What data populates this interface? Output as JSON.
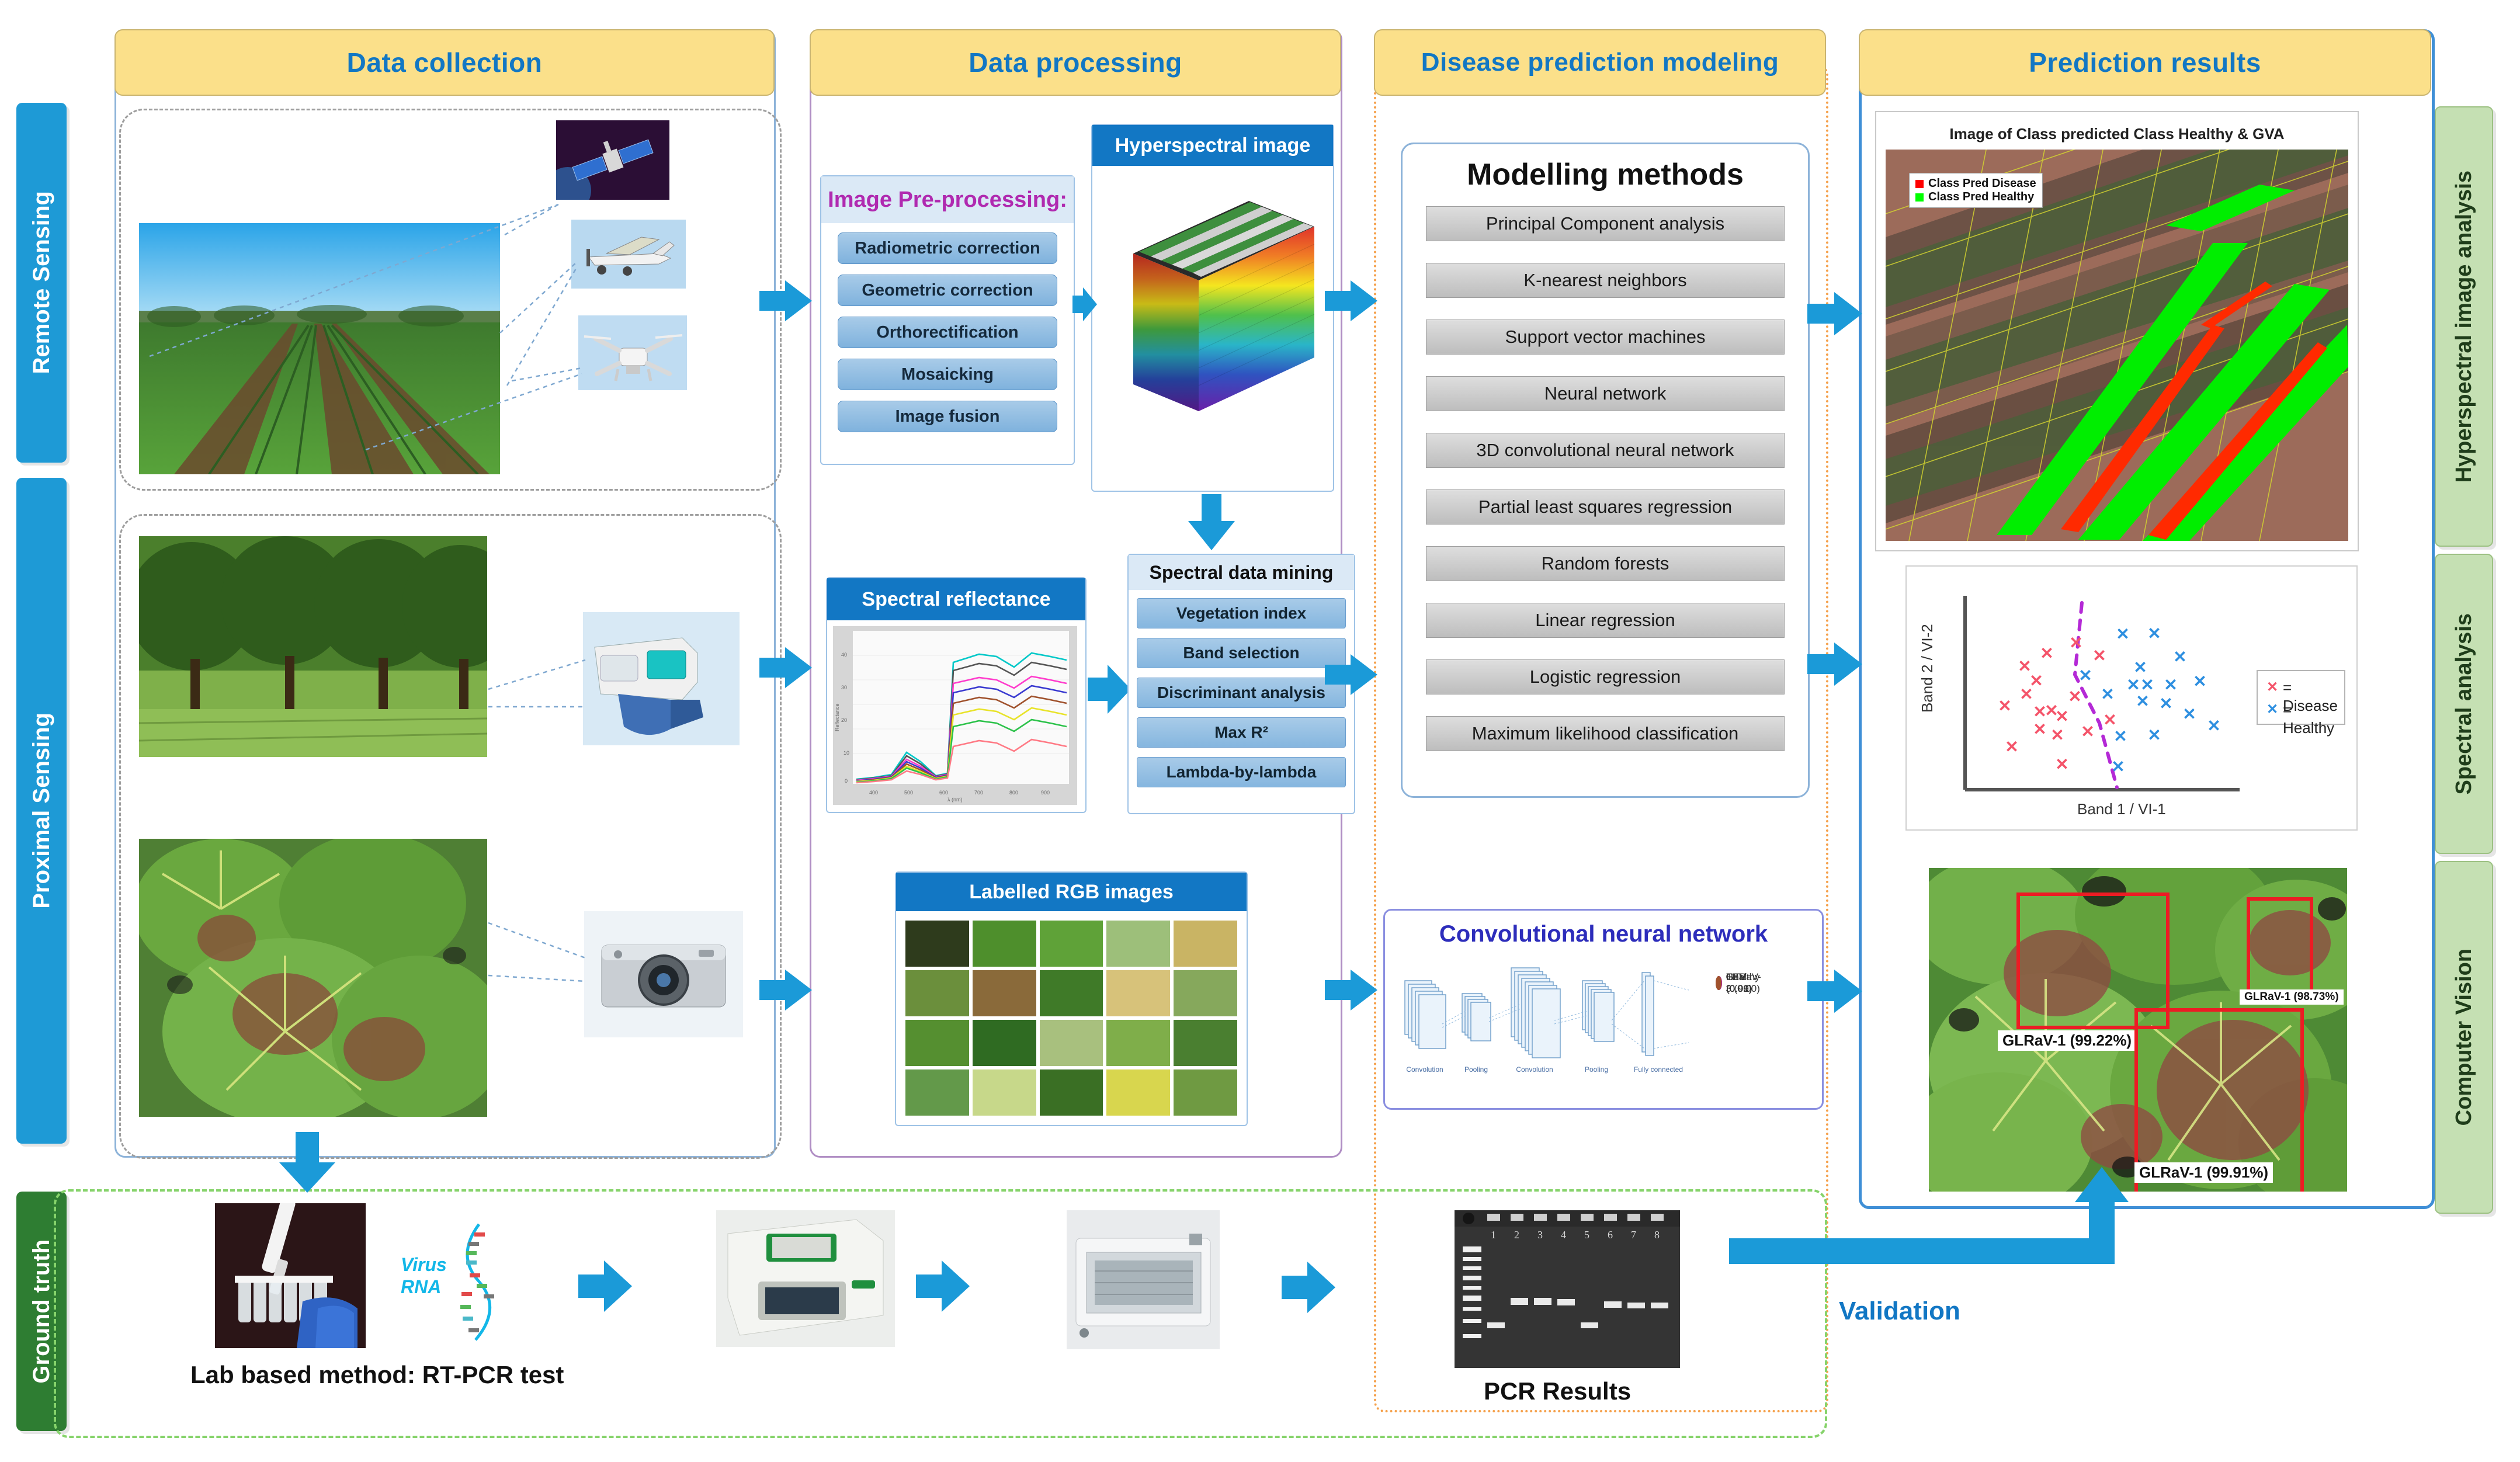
{
  "columns": [
    {
      "id": "data-collection",
      "title": "Data collection"
    },
    {
      "id": "data-processing",
      "title": "Data processing"
    },
    {
      "id": "disease-prediction-modeling",
      "title": "Disease prediction modeling"
    },
    {
      "id": "prediction-results",
      "title": "Prediction results"
    }
  ],
  "left_tabs": [
    {
      "id": "remote-sensing",
      "label": "Remote Sensing"
    },
    {
      "id": "proximal-sensing",
      "label": "Proximal Sensing"
    },
    {
      "id": "ground-truth",
      "label": "Ground truth"
    }
  ],
  "right_tabs": [
    {
      "id": "hyperspectral-image-analysis",
      "label": "Hyperspectral image analysis"
    },
    {
      "id": "spectral-analysis",
      "label": "Spectral analysis"
    },
    {
      "id": "computer-vision",
      "label": "Computer Vision"
    }
  ],
  "data_processing": {
    "preprocessing": {
      "title": "Image Pre-processing:",
      "steps": [
        "Radiometric correction",
        "Geometric correction",
        "Orthorectification",
        "Mosaicking",
        "Image fusion"
      ]
    },
    "hyperspectral_panel_title": "Hyperspectral image",
    "spectral_reflectance_title": "Spectral reflectance",
    "spectral_mining": {
      "title": "Spectral data mining",
      "steps": [
        "Vegetation index",
        "Band selection",
        "Discriminant analysis",
        "Max R²",
        "Lambda-by-lambda"
      ]
    },
    "labelled_rgb_title": "Labelled RGB images"
  },
  "modelling": {
    "title": "Modelling methods",
    "methods": [
      "Principal Component  analysis",
      "K-nearest neighbors",
      "Support vector machines",
      "Neural network",
      "3D convolutional neural network",
      "Partial least squares regression",
      "Random forests",
      "Linear regression",
      "Logistic regression",
      "Maximum likelihood classification"
    ]
  },
  "cnn": {
    "title": "Convolutional neural network",
    "stages": [
      "Convolution",
      "Pooling",
      "Convolution",
      "Pooling",
      "Fully connected"
    ],
    "outputs": [
      {
        "label": "Healthy (0.01)",
        "color": "#0aa80a"
      },
      {
        "label": "TBV (0.99)",
        "color": "#f08a1b"
      },
      {
        "label": "GTV (0.00)",
        "color": "#b31fb3"
      },
      {
        "label": "GLRaV-3 (0.00)",
        "color": "#a0522d"
      }
    ]
  },
  "results": {
    "map": {
      "title": "Image of Class predicted Class Healthy & GVA",
      "legend": [
        {
          "label": "Class Pred Disease",
          "color": "#ff0000"
        },
        {
          "label": "Class Pred Healthy",
          "color": "#00ff00"
        }
      ]
    },
    "scatter": {
      "xlabel": "Band 1 / VI-1",
      "ylabel": "Band 2 / VI-2",
      "legend": [
        {
          "label": "= Disease",
          "color": "#f4546a"
        },
        {
          "label": "= Healthy",
          "color": "#2e8fe0"
        }
      ]
    },
    "cv": {
      "detections": [
        {
          "label": "GLRaV-1 (99.22%)"
        },
        {
          "label": "GLRaV-1 (98.73%)"
        },
        {
          "label": "GLRaV-1 (99.91%)"
        }
      ]
    }
  },
  "ground_truth": {
    "rna_label": "Virus\nRNA",
    "caption": "Lab based method: RT-PCR test",
    "pcr_caption": "PCR Results",
    "lanes": [
      "1",
      "2",
      "3",
      "4",
      "5",
      "6",
      "7",
      "8"
    ]
  },
  "validation_label": "Validation",
  "chart_data": [
    {
      "type": "line",
      "title": "Spectral reflectance",
      "xlabel": "lambda",
      "ylabel": "Reflectance",
      "x": [
        400,
        450,
        500,
        550,
        600,
        650,
        700,
        750,
        800,
        850,
        900,
        950,
        1000
      ],
      "series": [
        {
          "name": "s1",
          "color": "#00c8c8",
          "values": [
            2,
            3,
            5,
            13,
            10,
            5,
            6,
            44,
            46,
            45,
            43,
            46,
            45
          ]
        },
        {
          "name": "s2",
          "color": "#555555",
          "values": [
            2,
            3,
            5,
            12,
            9,
            5,
            6,
            41,
            43,
            42,
            40,
            43,
            42
          ]
        },
        {
          "name": "s3",
          "color": "#ff3ccc",
          "values": [
            2,
            3,
            4,
            11,
            9,
            4,
            5,
            37,
            39,
            38,
            36,
            39,
            38
          ]
        },
        {
          "name": "s4",
          "color": "#3a3ad0",
          "values": [
            2,
            3,
            4,
            10,
            8,
            4,
            5,
            34,
            36,
            35,
            33,
            36,
            35
          ]
        },
        {
          "name": "s5",
          "color": "#a0522d",
          "values": [
            2,
            3,
            4,
            10,
            8,
            4,
            5,
            31,
            33,
            32,
            30,
            33,
            32
          ]
        },
        {
          "name": "s6",
          "color": "#e8e32a",
          "values": [
            2,
            3,
            4,
            9,
            7,
            4,
            5,
            27,
            29,
            28,
            26,
            29,
            28
          ]
        },
        {
          "name": "s7",
          "color": "#2cc24a",
          "values": [
            2,
            3,
            4,
            9,
            7,
            4,
            5,
            24,
            26,
            25,
            23,
            26,
            25
          ]
        },
        {
          "name": "s8",
          "color": "#ff7a85",
          "values": [
            2,
            3,
            4,
            8,
            6,
            3,
            4,
            16,
            18,
            17,
            15,
            18,
            17
          ]
        }
      ],
      "ylim": [
        0,
        50
      ],
      "grid": true,
      "legend": "none"
    },
    {
      "type": "scatter",
      "title": "",
      "xlabel": "Band 1 / VI-1",
      "ylabel": "Band 2 / VI-2",
      "grid": false,
      "legend": "right",
      "series": [
        {
          "name": "Disease",
          "color": "#f4546a",
          "points": [
            [
              24,
              80
            ],
            [
              18,
              72
            ],
            [
              13,
              65
            ],
            [
              16,
              58
            ],
            [
              11,
              50
            ],
            [
              6,
              46
            ],
            [
              14,
              43
            ],
            [
              16,
              43
            ],
            [
              19,
              40
            ],
            [
              15,
              33
            ],
            [
              18,
              30
            ],
            [
              24,
              33
            ],
            [
              30,
              44
            ],
            [
              27,
              67
            ],
            [
              29,
              61
            ],
            [
              32,
              36
            ],
            [
              21,
              22
            ],
            [
              9,
              26
            ]
          ]
        },
        {
          "name": "Healthy",
          "color": "#2e8fe0",
          "points": [
            [
              44,
              82
            ],
            [
              56,
              82
            ],
            [
              64,
              70
            ],
            [
              51,
              63
            ],
            [
              48,
              56
            ],
            [
              54,
              56
            ],
            [
              60,
              56
            ],
            [
              70,
              57
            ],
            [
              43,
              48
            ],
            [
              53,
              45
            ],
            [
              59,
              40
            ],
            [
              66,
              42
            ],
            [
              73,
              33
            ],
            [
              58,
              27
            ],
            [
              45,
              27
            ],
            [
              44,
              13
            ],
            [
              70,
              64
            ]
          ]
        }
      ],
      "boundary": {
        "color": "#b429d6",
        "style": "dashed"
      }
    }
  ]
}
